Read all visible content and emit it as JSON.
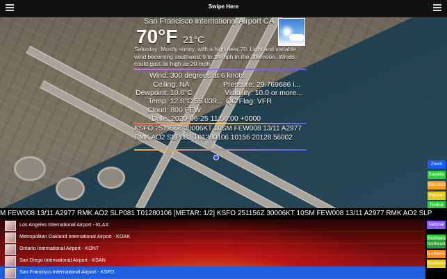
{
  "header": {
    "title": "Swipe Here"
  },
  "weather": {
    "airport_name": "San Francisco International Airport CA",
    "temp_f": "70°F",
    "temp_c": "21°C",
    "forecast": "Saturday: Mostly sunny, with a high near 70. Light and variable wind becoming southwest 9 to 14 mph in the afternoon. Winds could gust as high as 20 mph.",
    "wind": "Wind: 300 degrees at 6 knots",
    "ceiling": "Ceiling: NA",
    "pressure": "Pressure: 29.769686 i...",
    "dewpoint": "Dewpoint: 10.6°C",
    "visibility": "Visibility: 10.0 or more...",
    "temp_detail": "Temp: 12.8°C 55.039...",
    "qc_flag": "QC Flag: VFR",
    "cloud": "Cloud: 800 FEW",
    "date": "Date: 2020-06-25 11:56:00 +0000",
    "metar": "KSFO 251156Z 30006KT 10SM FEW008 13/11 A2977 RMK AO2 SLP081 T01280106 10156 20128 56002"
  },
  "map_buttons": [
    {
      "label": "Zoom",
      "color": "#1a5cff"
    },
    {
      "label": "Satellite",
      "color": "#2fcf3a"
    },
    {
      "label": "Standard",
      "color": "#ff9c1a"
    },
    {
      "label": "Flyover",
      "color": "#e6c81a"
    },
    {
      "label": "Retina",
      "color": "#2fcf3a"
    }
  ],
  "ticker": "M FEW008 13/11 A2977 RMK AO2 SLP081 T01280106 [METAR: 1/2] KSFO 251156Z 30006KT 10SM FEW008 13/11 A2977 RMK AO2 SLP",
  "airports": [
    {
      "name": "Los Angeles International Airport - KLAX",
      "selected": false
    },
    {
      "name": "Metropolitan Oakland International Airport - KOAK",
      "selected": false
    },
    {
      "name": "Ontario International Airport - KONT",
      "selected": false
    },
    {
      "name": "San Diego International Airport - KSAN",
      "selected": false
    },
    {
      "name": "San Francisco International Airport - KSFO",
      "selected": true
    }
  ],
  "regions": [
    {
      "label": "National",
      "color": "#8a5cff"
    },
    {
      "label": "Southwest",
      "color": "#2fcf3a"
    },
    {
      "label": "Northeast",
      "color": "#2f9f3a"
    },
    {
      "label": "Northwest",
      "color": "#ff8a1a"
    },
    {
      "label": "Southeast",
      "color": "#e6c81a"
    }
  ]
}
